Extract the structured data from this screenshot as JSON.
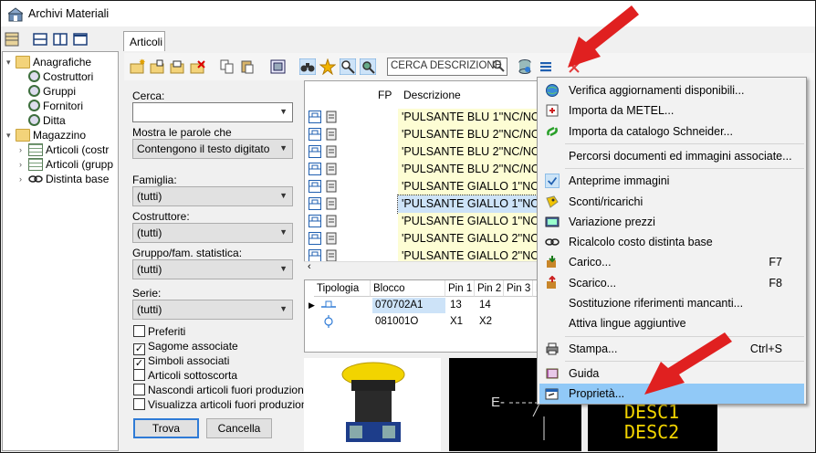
{
  "window": {
    "title": "Archivi Materiali"
  },
  "tree": {
    "items": [
      {
        "label": "Anagrafiche",
        "level": 0,
        "icon": "folder-icon",
        "expander": "▾"
      },
      {
        "label": "Costruttori",
        "level": 1,
        "icon": "gear-icon",
        "expander": ""
      },
      {
        "label": "Gruppi",
        "level": 1,
        "icon": "gear-icon",
        "expander": ""
      },
      {
        "label": "Fornitori",
        "level": 1,
        "icon": "gear-icon",
        "expander": ""
      },
      {
        "label": "Ditta",
        "level": 1,
        "icon": "gear-icon",
        "expander": ""
      },
      {
        "label": "Magazzino",
        "level": 0,
        "icon": "folder-icon",
        "expander": "▾"
      },
      {
        "label": "Articoli (costr",
        "level": 1,
        "icon": "grid-icon",
        "expander": "›"
      },
      {
        "label": "Articoli (grupp",
        "level": 1,
        "icon": "grid-icon",
        "expander": "›"
      },
      {
        "label": "Distinta base",
        "level": 1,
        "icon": "chain-icon",
        "expander": "›"
      }
    ]
  },
  "tab": {
    "label": "Articoli"
  },
  "search": {
    "placeholder": "CERCA DESCRIZIONE"
  },
  "filters": {
    "cerca_label": "Cerca:",
    "cerca_value": "",
    "parole_label": "Mostra le parole che",
    "parole_value": "Contengono il testo digitato",
    "famiglia_label": "Famiglia:",
    "famiglia_value": "(tutti)",
    "costruttore_label": "Costruttore:",
    "costruttore_value": "(tutti)",
    "gruppo_label": "Gruppo/fam. statistica:",
    "gruppo_value": "(tutti)",
    "serie_label": "Serie:",
    "serie_value": "(tutti)",
    "checkboxes": [
      {
        "label": "Preferiti",
        "checked": false
      },
      {
        "label": "Sagome associate",
        "checked": true
      },
      {
        "label": "Simboli associati",
        "checked": true
      },
      {
        "label": "Articoli sottoscorta",
        "checked": false
      },
      {
        "label": "Nascondi articoli fuori produzione",
        "checked": false
      },
      {
        "label": "Visualizza articoli fuori produzione",
        "checked": false
      }
    ],
    "trova_label": "Trova",
    "cancella_label": "Cancella"
  },
  "grid": {
    "headers": {
      "fp": "FP",
      "descrizione": "Descrizione"
    },
    "rows": [
      {
        "descrizione": "'PULSANTE BLU 1''NC/NO''",
        "selected": false
      },
      {
        "descrizione": "'PULSANTE BLU 2''NC/NO''",
        "selected": false
      },
      {
        "descrizione": "'PULSANTE BLU 2''NC/NO''",
        "selected": false
      },
      {
        "descrizione": "'PULSANTE BLU 2''NC/NO''",
        "selected": false
      },
      {
        "descrizione": "'PULSANTE GIALLO 1''NC/N",
        "selected": false
      },
      {
        "descrizione": "'PULSANTE GIALLO 1''NC/N",
        "selected": true
      },
      {
        "descrizione": "'PULSANTE GIALLO 1''NC/N",
        "selected": false
      },
      {
        "descrizione": "'PULSANTE GIALLO 2''NC/N",
        "selected": false
      },
      {
        "descrizione": "'PULSANTE GIALLO 2''NC/N",
        "selected": false
      }
    ]
  },
  "bottom_grid": {
    "headers": [
      "Tipologia",
      "Blocco",
      "Pin 1",
      "Pin 2",
      "Pin 3",
      "P"
    ],
    "rows": [
      {
        "blocco": "070702A1",
        "pin1": "13",
        "pin2": "14"
      },
      {
        "blocco": "081001O",
        "pin1": "X1",
        "pin2": "X2"
      }
    ]
  },
  "preview": {
    "symbol_text": "E-",
    "desc_lines": [
      "DESC1",
      "DESC2"
    ]
  },
  "menu": {
    "items": [
      {
        "label": "Verifica aggiornamenti disponibili...",
        "shortcut": "",
        "icon": "globe-icon",
        "checked": false,
        "highlighted": false
      },
      {
        "label": "Importa da METEL...",
        "shortcut": "",
        "icon": "import-metel-icon",
        "checked": false,
        "highlighted": false
      },
      {
        "label": "Importa da catalogo Schneider...",
        "shortcut": "",
        "icon": "schneider-icon",
        "checked": false,
        "highlighted": false
      },
      {
        "label": "Percorsi documenti ed immagini associate...",
        "shortcut": "",
        "icon": "",
        "checked": false,
        "highlighted": false,
        "sep_before": true
      },
      {
        "label": "Anteprime immagini",
        "shortcut": "",
        "icon": "check-icon",
        "checked": true,
        "highlighted": false,
        "sep_before": true
      },
      {
        "label": "Sconti/ricarichi",
        "shortcut": "",
        "icon": "discount-icon",
        "checked": false,
        "highlighted": false
      },
      {
        "label": "Variazione prezzi",
        "shortcut": "",
        "icon": "price-icon",
        "checked": false,
        "highlighted": false
      },
      {
        "label": "Ricalcolo costo distinta base",
        "shortcut": "",
        "icon": "chain-icon",
        "checked": false,
        "highlighted": false
      },
      {
        "label": "Carico...",
        "shortcut": "F7",
        "icon": "load-icon",
        "checked": false,
        "highlighted": false
      },
      {
        "label": "Scarico...",
        "shortcut": "F8",
        "icon": "unload-icon",
        "checked": false,
        "highlighted": false
      },
      {
        "label": "Sostituzione riferimenti mancanti...",
        "shortcut": "",
        "icon": "",
        "checked": false,
        "highlighted": false
      },
      {
        "label": "Attiva lingue aggiuntive",
        "shortcut": "",
        "icon": "",
        "checked": false,
        "highlighted": false
      },
      {
        "label": "Stampa...",
        "shortcut": "Ctrl+S",
        "icon": "printer-icon",
        "checked": false,
        "highlighted": false,
        "sep_before": true
      },
      {
        "label": "Guida",
        "shortcut": "",
        "icon": "book-icon",
        "checked": false,
        "highlighted": false,
        "sep_before": true
      },
      {
        "label": "Proprietà...",
        "shortcut": "",
        "icon": "properties-icon",
        "checked": false,
        "highlighted": true
      }
    ]
  },
  "colors": {
    "accent": "#2f7bd6",
    "menu_highlight": "#91c9f7",
    "row_yellow": "#fdfdd4",
    "annotation_red": "#e02020"
  }
}
